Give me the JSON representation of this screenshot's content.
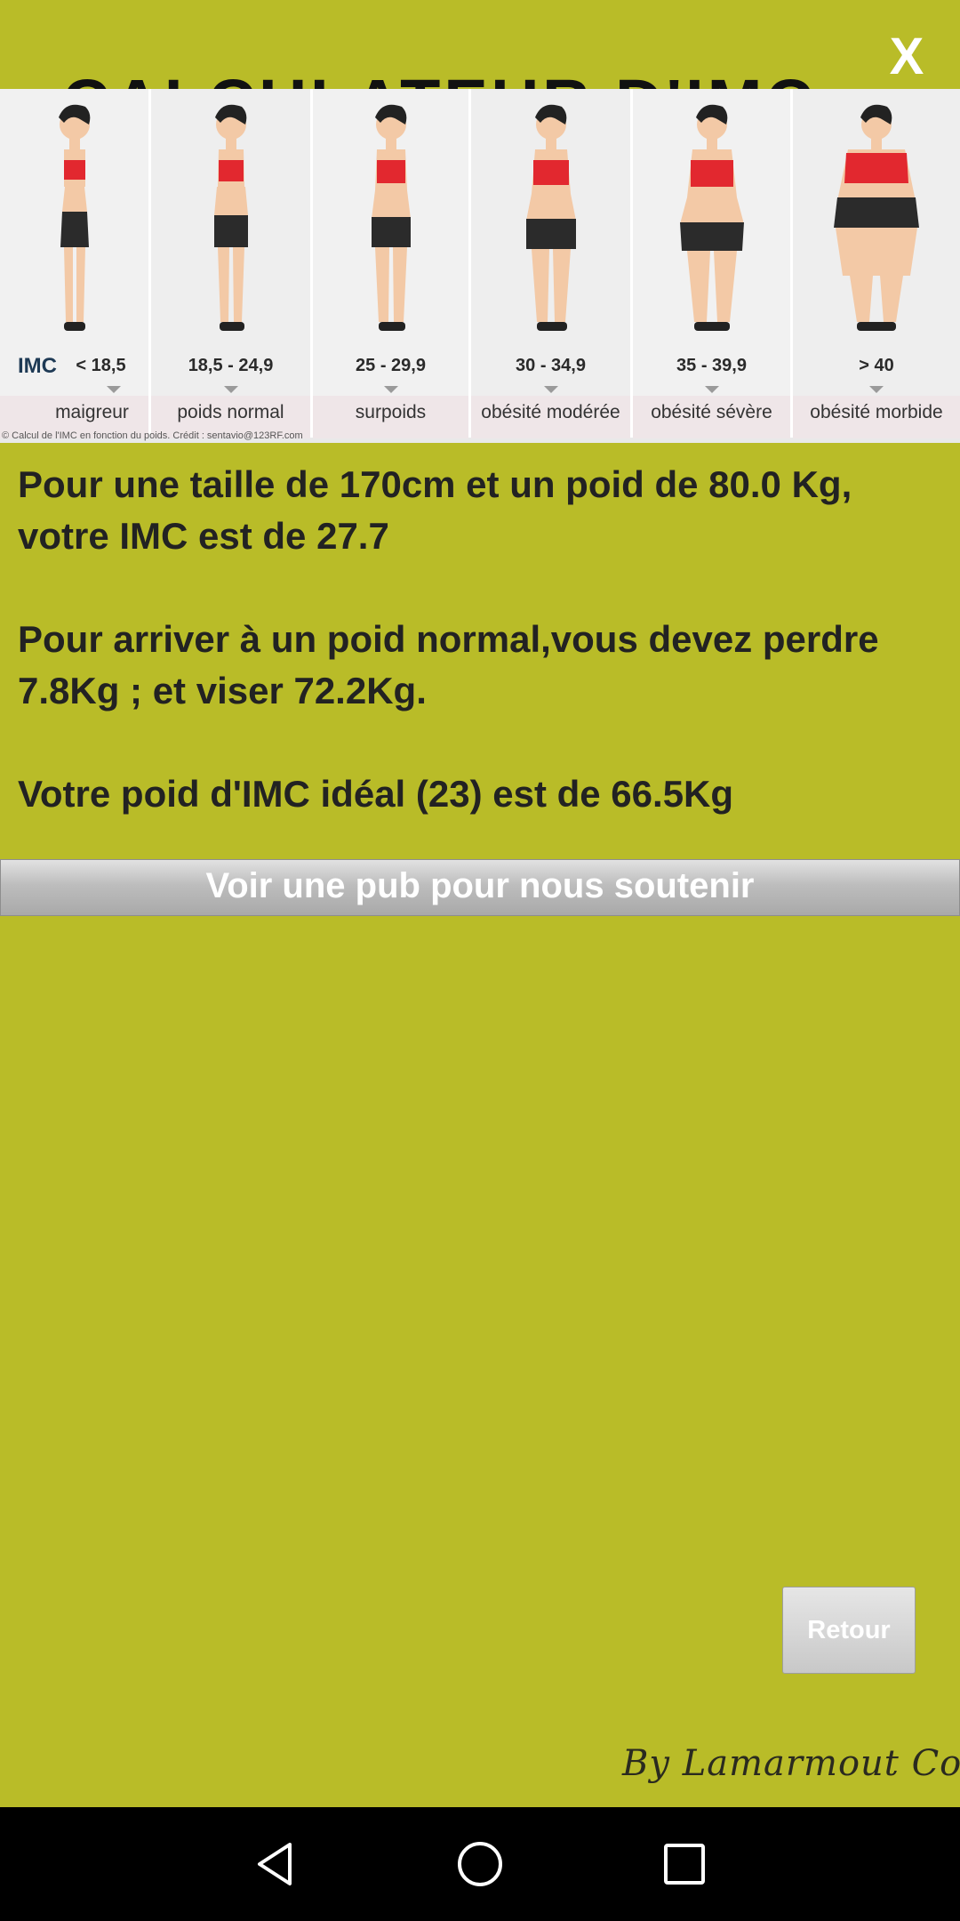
{
  "header": {
    "background_title": "CALCULATEUR D'IMC",
    "close_label": "X"
  },
  "banner": {
    "imc_label": "IMC",
    "categories": [
      {
        "range": "< 18,5",
        "label": "maigreur"
      },
      {
        "range": "18,5 - 24,9",
        "label": "poids normal"
      },
      {
        "range": "25 - 29,9",
        "label": "surpoids"
      },
      {
        "range": "30 - 34,9",
        "label": "obésité modérée"
      },
      {
        "range": "35 - 39,9",
        "label": "obésité sévère"
      },
      {
        "range": "> 40",
        "label": "obésité morbide"
      }
    ],
    "credit": "© Calcul de l'IMC en fonction du poids. Crédit : sentavio@123RF.com"
  },
  "result": {
    "line1": "Pour une taille de 170cm et un poid de 80.0 Kg, votre IMC est de 27.7",
    "line2": "Pour arriver à un poid normal,vous devez perdre 7.8Kg ; et viser 72.2Kg.",
    "line3": "Votre poid d'IMC idéal (23) est de 66.5Kg"
  },
  "actions": {
    "ad_button": "Voir une pub pour nous soutenir",
    "back_button": "Retour"
  },
  "footer": {
    "signature": "By Lamarmout Corp"
  },
  "colors": {
    "background": "#b9bc28",
    "top_red": "#e2282f",
    "bottom_black": "#2b2b2b",
    "skin": "#f3c9a6"
  }
}
